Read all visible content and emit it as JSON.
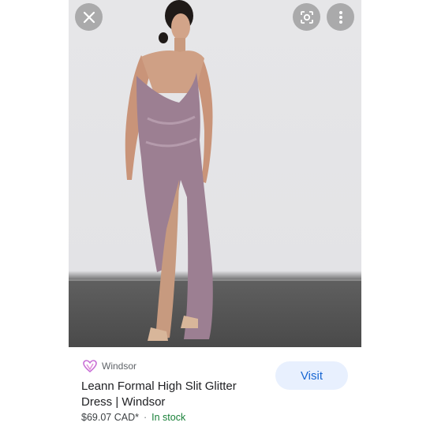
{
  "viewer": {
    "image_subject": "model wearing mauve glitter gown",
    "close_icon": "close-icon",
    "lens_icon": "lens-icon",
    "more_icon": "more-vert-icon"
  },
  "result": {
    "source_name": "Windsor",
    "source_logo_icon": "heart-logo-icon",
    "title": "Leann Formal High Slit Glitter Dress | Windsor",
    "price": "$69.07 CAD*",
    "separator": "·",
    "stock_status": "In stock",
    "visit_label": "Visit"
  },
  "colors": {
    "accent": "#1967d2",
    "visit_bg": "#e8f0fe",
    "stock_green": "#188038",
    "dress": "#9c7f92"
  }
}
